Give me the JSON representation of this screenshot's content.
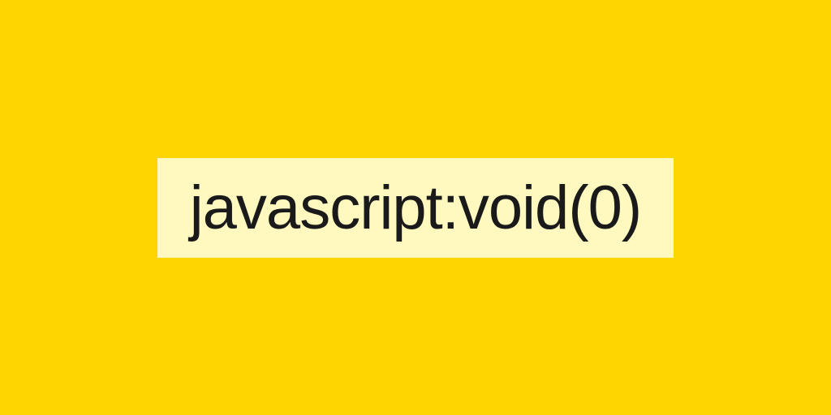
{
  "banner": {
    "text": "javascript:void(0)"
  }
}
